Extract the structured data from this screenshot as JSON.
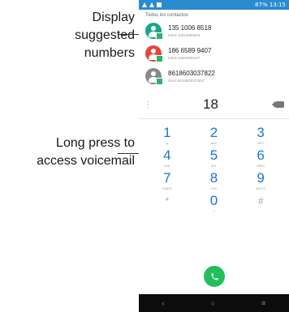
{
  "callouts": {
    "top": [
      "Display",
      "suggested",
      "numbers"
    ],
    "bottom": [
      "Long press to",
      "access voicemail"
    ]
  },
  "status": {
    "right": "87%  13:15"
  },
  "contacts": {
    "header": "Todos los contactos",
    "items": [
      {
        "number": "135 1006 8518",
        "sub": "Móvil 13510068518",
        "color": "#1aa58c"
      },
      {
        "number": "186 6589 9407",
        "sub": "Móvil 18665899407",
        "color": "#e2473b"
      },
      {
        "number": "8618603037822",
        "sub": "Móvil 8618603037822",
        "color": "#8a8a8a"
      }
    ]
  },
  "dialer": {
    "typed": "18"
  },
  "keypad": [
    {
      "d": "1",
      "l": "ϙ"
    },
    {
      "d": "2",
      "l": "ABC"
    },
    {
      "d": "3",
      "l": "DEF"
    },
    {
      "d": "4",
      "l": "GHI"
    },
    {
      "d": "5",
      "l": "JKL"
    },
    {
      "d": "6",
      "l": "MNO"
    },
    {
      "d": "7",
      "l": "PQRS"
    },
    {
      "d": "8",
      "l": "TUV"
    },
    {
      "d": "9",
      "l": "WXYZ"
    },
    {
      "d": "*",
      "l": ""
    },
    {
      "d": "0",
      "l": "+"
    },
    {
      "d": "#",
      "l": ""
    }
  ],
  "nav": {
    "back": "‹",
    "home": "○",
    "recents": "≡"
  }
}
